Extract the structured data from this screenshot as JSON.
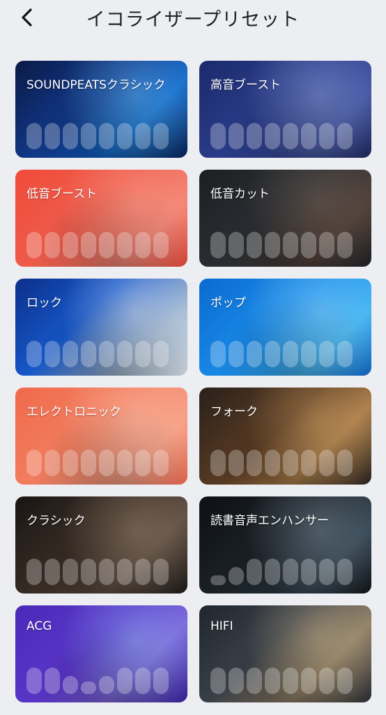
{
  "header": {
    "title": "イコライザープリセット"
  },
  "presets": [
    {
      "label": "SOUNDPEATSクラシック",
      "bg": "linear-gradient(135deg,#0a1a46 0%,#123a8c 45%,#0e64c8 70%,#0a2254 100%)",
      "glow": "#7ad2ff"
    },
    {
      "label": "高音ブースト",
      "bg": "linear-gradient(135deg,#1b2a6b 0%,#2d3f8f 50%,#3a4d9c 75%,#20285e 100%)",
      "glow": "#a8b8e8"
    },
    {
      "label": "低音ブースト",
      "bg": "linear-gradient(135deg,#f04b3a 0%,#ee5d4c 45%,#f28070 75%,#e4483a 100%)",
      "glow": "#ffb0a0"
    },
    {
      "label": "低音カット",
      "bg": "linear-gradient(135deg,#1c1f22 0%,#2b2f33 45%,#4a3b35 75%,#1e2124 100%)",
      "glow": "#8a7060"
    },
    {
      "label": "ロック",
      "bg": "linear-gradient(135deg,#0c2f8a 0%,#1657c8 40%,#9fb6cf 75%,#d4dde6 100%)",
      "glow": "#f0f4f8"
    },
    {
      "label": "ポップ",
      "bg": "linear-gradient(135deg,#0a6ad0 0%,#1a8be8 45%,#3ab0f0 75%,#1268c6 100%)",
      "glow": "#a9e2ff"
    },
    {
      "label": "エレクトロニック",
      "bg": "linear-gradient(135deg,#f06a4c 0%,#f27f60 45%,#f59a7e 75%,#ee6a50 100%)",
      "glow": "#ffd0c0"
    },
    {
      "label": "フォーク",
      "bg": "linear-gradient(135deg,#2a201a 0%,#5a3c24 45%,#a87a48 70%,#2a2420 100%)",
      "glow": "#e0b070"
    },
    {
      "label": "クラシック",
      "bg": "linear-gradient(135deg,#1a1614 0%,#3a2e26 45%,#5a4a3e 70%,#1e1a18 100%)",
      "glow": "#b09880"
    },
    {
      "label": "読書音声エンハンサー",
      "bg": "linear-gradient(135deg,#0d1014 0%,#1c2228 45%,#30404c 75%,#12161a 100%)",
      "glow": "#90a4b4"
    },
    {
      "label": "ACG",
      "bg": "linear-gradient(135deg,#4a2ab8 0%,#5a36c8 45%,#7a60d8 70%,#3a22a0 100%)",
      "glow": "#9ad0ff"
    },
    {
      "label": "HIFI",
      "bg": "linear-gradient(135deg,#20262c 0%,#3a4048 40%,#8a7a62 70%,#2a2e34 100%)",
      "glow": "#e0c89a"
    }
  ]
}
